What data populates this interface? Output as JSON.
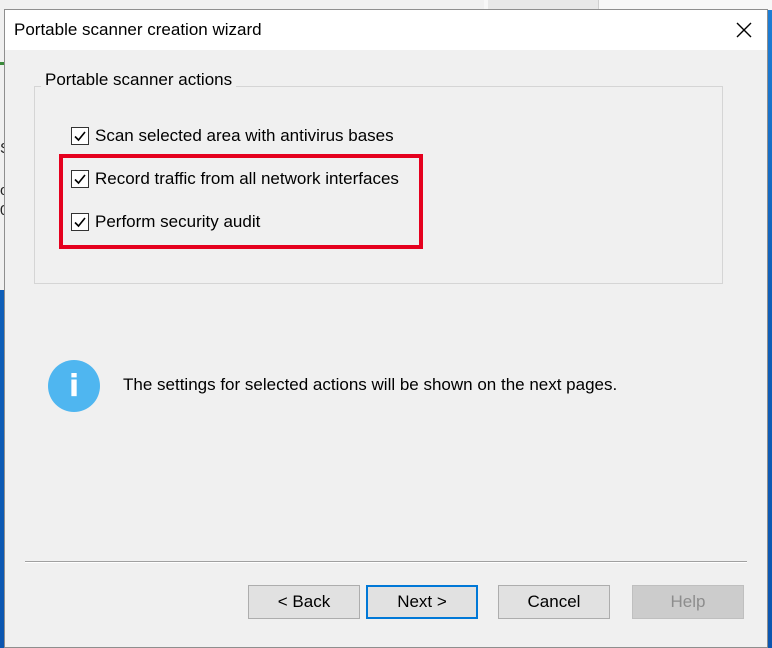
{
  "background": {
    "partial_chars": [
      "S",
      "o",
      "0"
    ]
  },
  "dialog": {
    "title": "Portable scanner creation wizard",
    "close_icon": "close-icon",
    "group": {
      "legend": "Portable scanner actions",
      "options": [
        {
          "label": "Scan selected area with antivirus bases",
          "checked": true
        },
        {
          "label": "Record traffic from all network interfaces",
          "checked": true
        },
        {
          "label": "Perform security audit",
          "checked": true
        }
      ],
      "highlight_color": "#e5001e"
    },
    "info": {
      "icon": "info-icon",
      "icon_glyph": "i",
      "text": "The settings for selected actions will be shown on the next pages."
    },
    "buttons": {
      "back": "< Back",
      "next": "Next >",
      "cancel": "Cancel",
      "help": "Help"
    }
  },
  "colors": {
    "accent": "#0078d7",
    "info_icon": "#4fb6f0",
    "dialog_bg": "#f0f0f0"
  }
}
